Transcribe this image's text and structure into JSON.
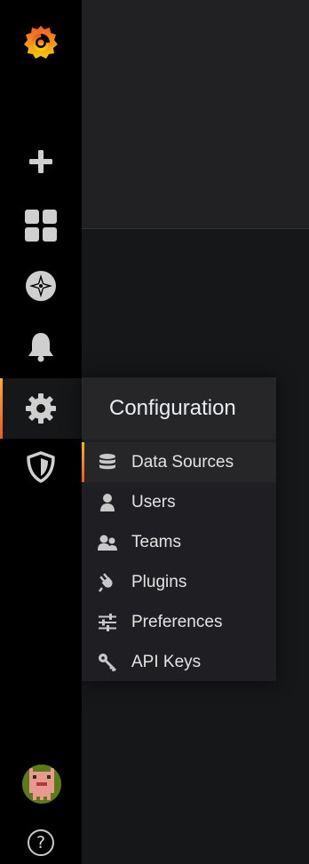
{
  "sidebar": {
    "items": [
      {
        "name": "logo",
        "icon": "grafana-logo-icon"
      },
      {
        "name": "create",
        "icon": "plus-icon"
      },
      {
        "name": "dashboards",
        "icon": "apps-icon"
      },
      {
        "name": "explore",
        "icon": "compass-icon"
      },
      {
        "name": "alerting",
        "icon": "bell-icon"
      },
      {
        "name": "configuration",
        "icon": "gear-icon",
        "active": true
      },
      {
        "name": "server-admin",
        "icon": "shield-icon"
      }
    ],
    "help_label": "?"
  },
  "flyout": {
    "title": "Configuration",
    "items": [
      {
        "label": "Data Sources",
        "icon": "database-icon",
        "active": true
      },
      {
        "label": "Users",
        "icon": "user-icon"
      },
      {
        "label": "Teams",
        "icon": "users-icon"
      },
      {
        "label": "Plugins",
        "icon": "plug-icon"
      },
      {
        "label": "Preferences",
        "icon": "sliders-icon"
      },
      {
        "label": "API Keys",
        "icon": "key-icon"
      }
    ]
  },
  "colors": {
    "accent_gradient_start": "#ffad21",
    "accent_gradient_end": "#ed5825",
    "sidebar_bg": "#000000",
    "page_bg": "#161719"
  }
}
